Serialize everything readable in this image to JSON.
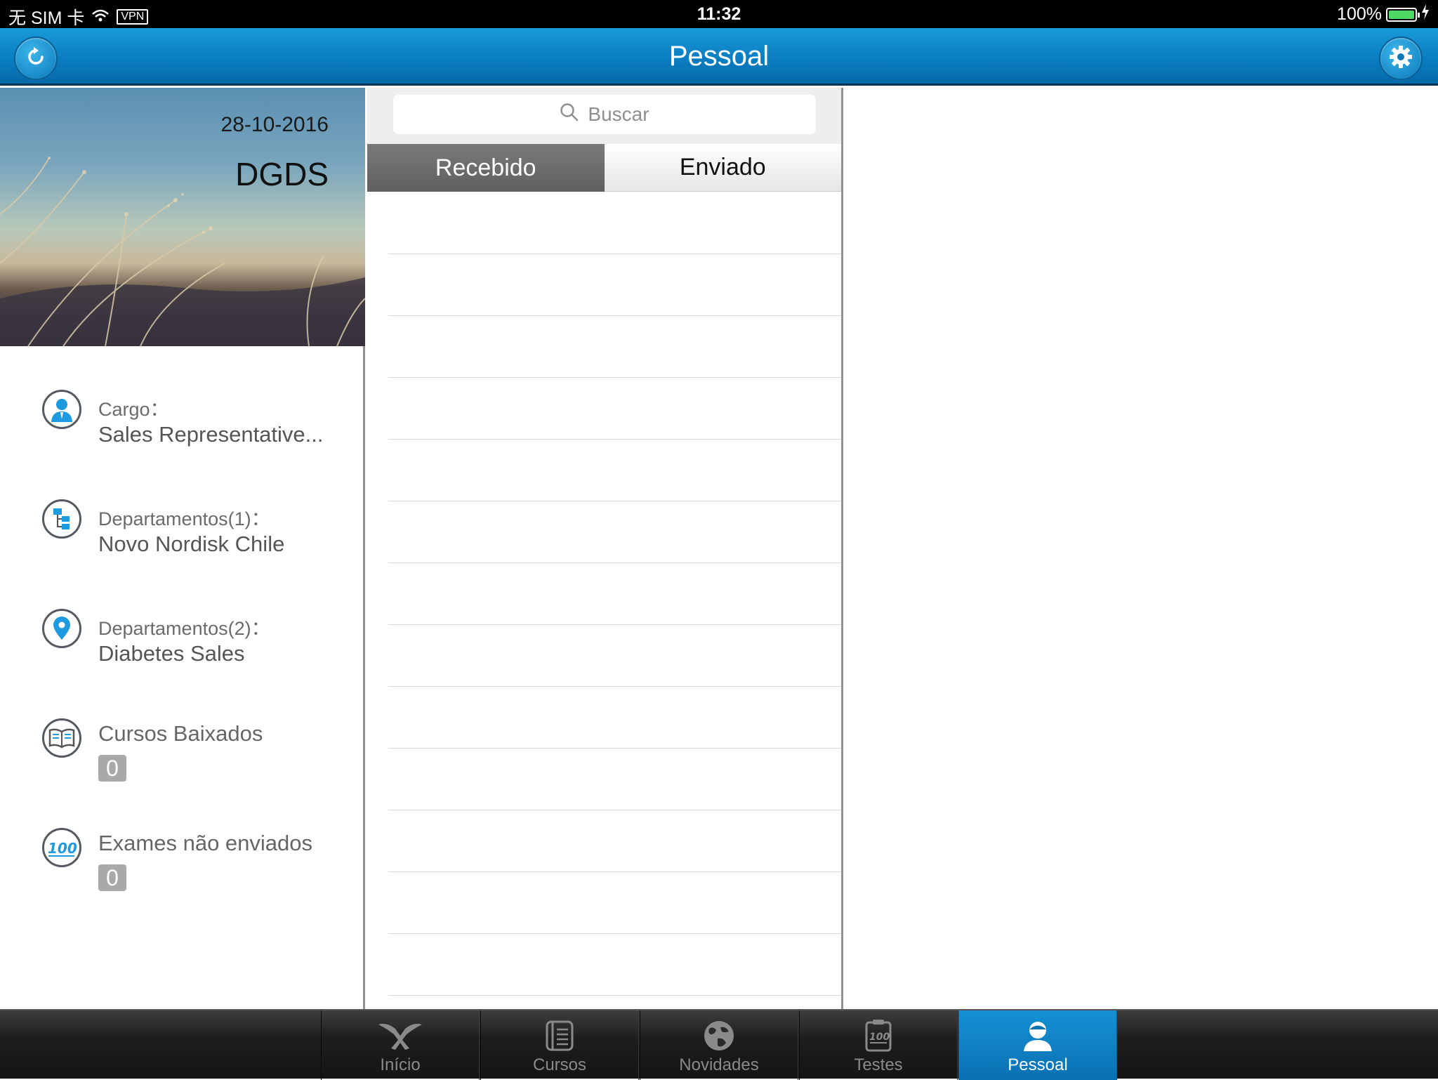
{
  "status_bar": {
    "carrier": "无 SIM 卡",
    "vpn": "VPN",
    "time": "11:32",
    "battery": "100%",
    "battery_color": "#4cd964"
  },
  "nav": {
    "title": "Pessoal",
    "left_icon": "refresh-icon",
    "right_icon": "gear-icon",
    "accent": "#0a7ec2"
  },
  "profile": {
    "date": "28-10-2016",
    "name": "DGDS",
    "items": [
      {
        "icon": "person-icon",
        "label": "Cargo：",
        "value": "Sales Representative..."
      },
      {
        "icon": "org-chart-icon",
        "label": "Departamentos(1)：",
        "value": "Novo Nordisk Chile"
      },
      {
        "icon": "location-pin-icon",
        "label": "Departamentos(2)：",
        "value": "Diabetes Sales"
      },
      {
        "icon": "book-icon",
        "label": "Cursos Baixados",
        "count": "0"
      },
      {
        "icon": "score-100-icon",
        "label": "Exames não enviados",
        "count": "0"
      }
    ]
  },
  "messages": {
    "search_placeholder": "Buscar",
    "segments": [
      "Recebido",
      "Enviado"
    ],
    "active_segment": "Recebido"
  },
  "tabs": [
    {
      "label": "Início",
      "icon": "home-bird-icon",
      "active": false
    },
    {
      "label": "Cursos",
      "icon": "document-icon",
      "active": false
    },
    {
      "label": "Novidades",
      "icon": "globe-icon",
      "active": false
    },
    {
      "label": "Testes",
      "icon": "clipboard-100-icon",
      "active": false
    },
    {
      "label": "Pessoal",
      "icon": "person-icon",
      "active": true
    }
  ]
}
